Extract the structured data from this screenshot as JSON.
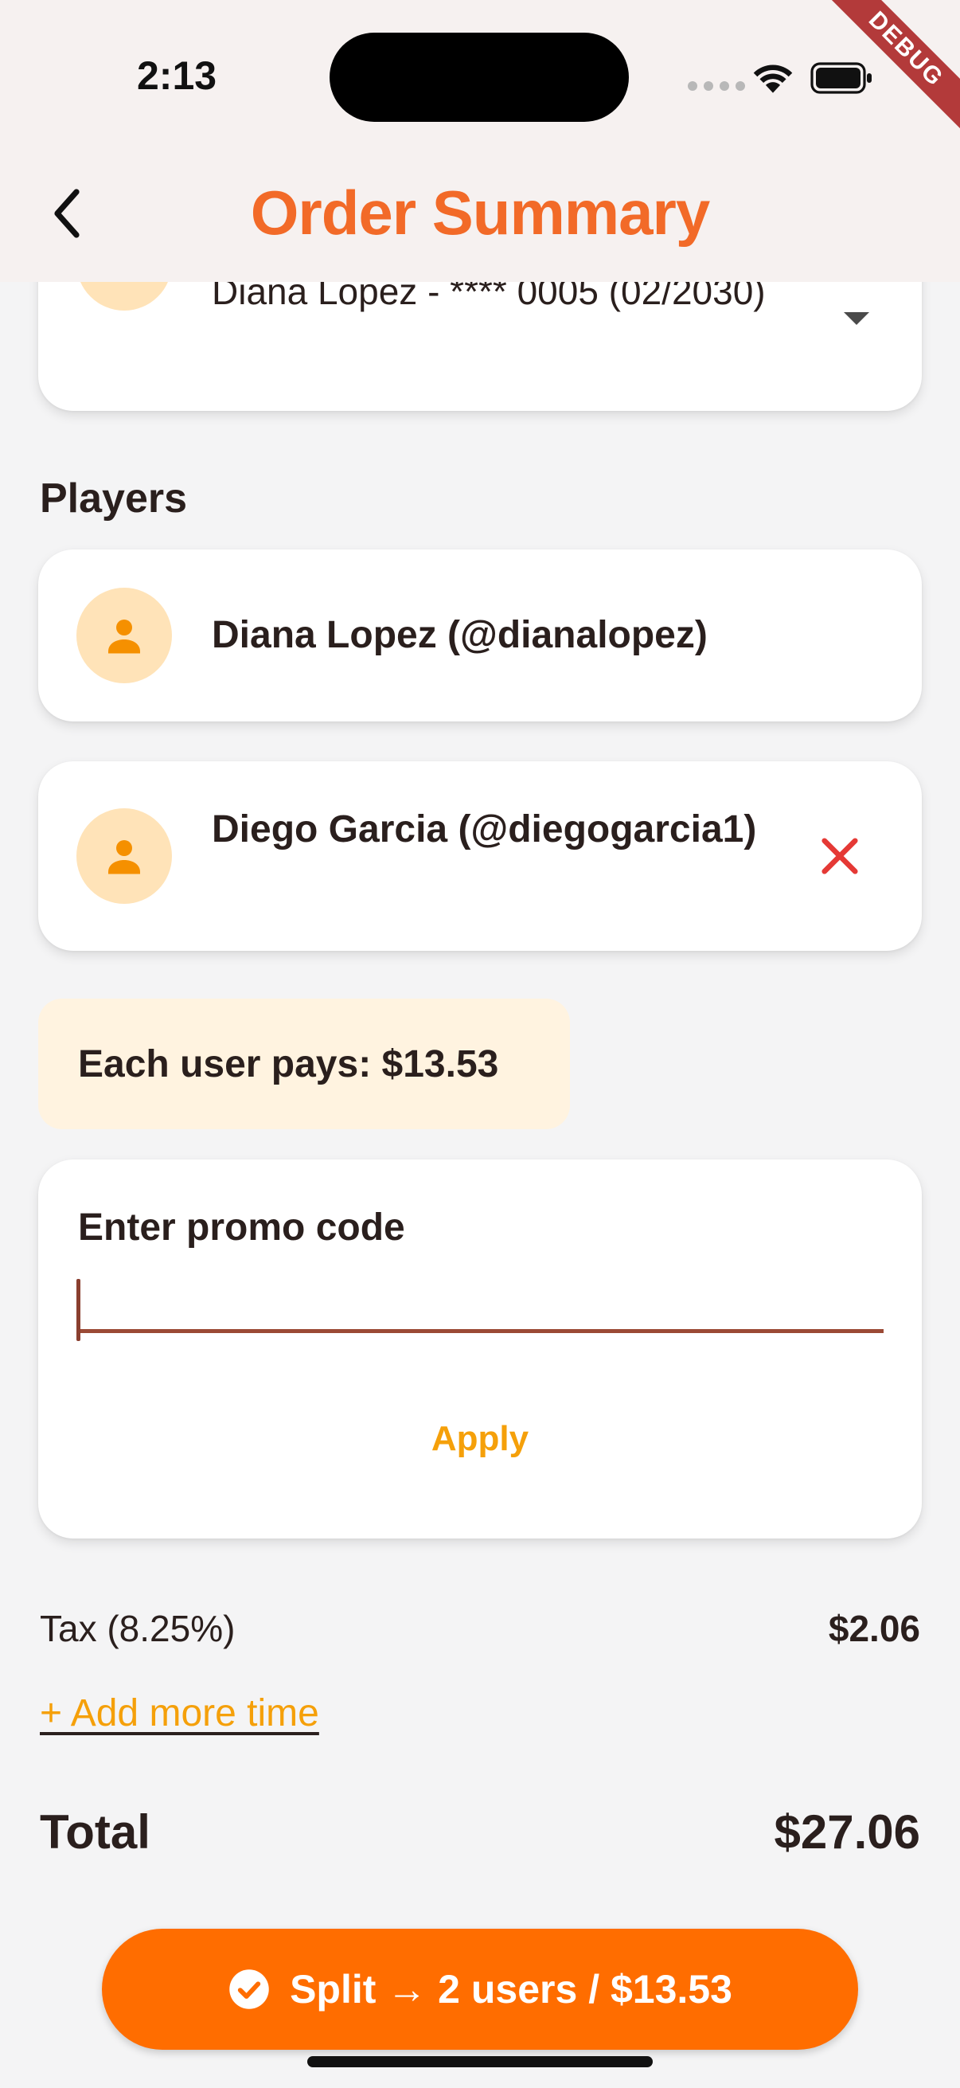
{
  "status_bar": {
    "time": "2:13"
  },
  "debug_banner": "DEBUG",
  "appbar": {
    "title": "Order Summary"
  },
  "payment": {
    "method_text": "Diana Lopez - **** 0005 (02/2030)"
  },
  "players": {
    "section_title": "Players",
    "items": [
      {
        "name": "Diana Lopez (@dianalopez)"
      },
      {
        "name": "Diego Garcia (@diegogarcia1)"
      }
    ]
  },
  "split": {
    "each_user_pays": "Each user pays: $13.53"
  },
  "promo": {
    "label": "Enter promo code",
    "value": "",
    "apply_label": "Apply"
  },
  "summary": {
    "tax_label": "Tax (8.25%)",
    "tax_value": "$2.06",
    "add_time_label": "+ Add more time",
    "total_label": "Total",
    "total_value": "$27.06"
  },
  "action": {
    "split_button_label": "Split → 2 users / $13.53"
  },
  "colors": {
    "accent": "#ff6d00",
    "title": "#f26a28",
    "link": "#f5a00a",
    "remove": "#e53935",
    "avatar_bg": "#ffe3b8",
    "avatar_icon": "#f59000"
  }
}
